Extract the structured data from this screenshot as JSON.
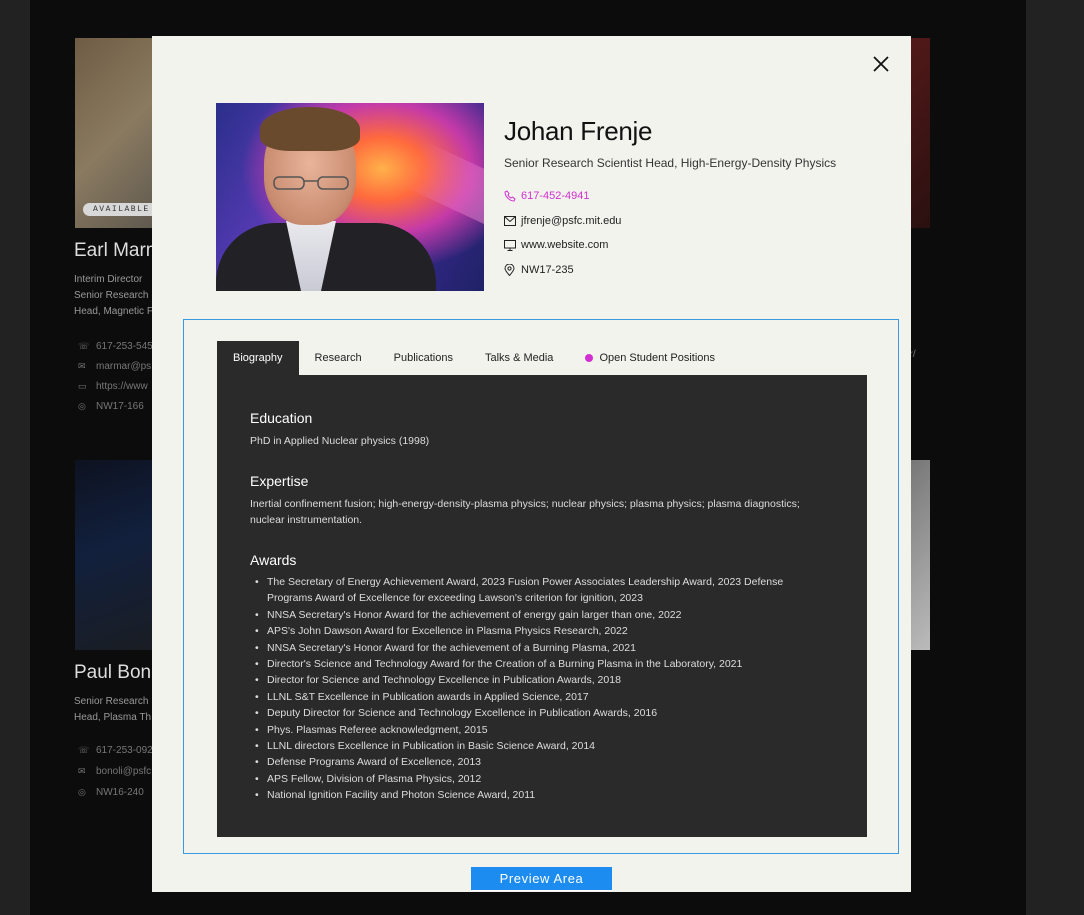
{
  "background": {
    "card1": {
      "badge": "AVAILABLE S",
      "name": "Earl Marm",
      "lines": [
        "Interim Director",
        "Senior Research",
        "Head, Magnetic F"
      ],
      "contacts": [
        "617-253-545",
        "marmar@ps",
        "https://www",
        "NW17-166"
      ]
    },
    "card2": {
      "name": "Paul Bonol",
      "lines": [
        "Senior Research",
        "Head, Plasma Th"
      ],
      "contacts": [
        "617-253-092",
        "bonoli@psfc",
        "NW16-240"
      ]
    },
    "side_text": "or/"
  },
  "modal": {
    "close_label": "",
    "name": "Johan Frenje",
    "title": "Senior Research Scientist Head, High-Energy-Density Physics",
    "phone": "617-452-4941",
    "email": "jfrenje@psfc.mit.edu",
    "website": "www.website.com",
    "location": "NW17-235",
    "tabs": [
      {
        "label": "Biography",
        "active": true
      },
      {
        "label": "Research"
      },
      {
        "label": "Publications"
      },
      {
        "label": "Talks & Media"
      },
      {
        "label": "Open Student Positions"
      }
    ],
    "biography": {
      "education_heading": "Education",
      "education_text": "PhD in Applied Nuclear physics (1998)",
      "expertise_heading": "Expertise",
      "expertise_text": "Inertial confinement fusion; high-energy-density-plasma physics; nuclear physics; plasma physics; plasma diagnostics; nuclear instrumentation.",
      "awards_heading": "Awards",
      "awards": [
        "The Secretary of Energy Achievement Award, 2023 Fusion Power Associates Leadership Award, 2023 Defense Programs Award of Excellence for exceeding Lawson's criterion for ignition, 2023",
        "NNSA Secretary's Honor Award for the achievement of energy gain larger than one, 2022",
        "APS's John Dawson Award for Excellence in Plasma Physics Research, 2022",
        "NNSA Secretary's Honor Award for the achievement of a Burning Plasma, 2021",
        "Director's Science and Technology Award for the Creation of a Burning Plasma in the Laboratory, 2021",
        "Director for Science and Technology Excellence in Publication Awards, 2018",
        "LLNL S&T Excellence in Publication awards in Applied Science, 2017",
        "Deputy Director for Science and Technology Excellence in Publication Awards, 2016",
        "Phys. Plasmas Referee acknowledgment, 2015",
        "LLNL directors Excellence in Publication in Basic Science Award, 2014",
        "Defense Programs Award of Excellence, 2013",
        "APS Fellow, Division of Plasma Physics, 2012",
        "National Ignition Facility and Photon Science Award, 2011"
      ]
    },
    "preview_label": "Preview Area"
  },
  "colors": {
    "accent_magenta": "#d22fd0",
    "preview_blue": "#1d8cf0",
    "panel_dark": "#2a2a2a",
    "modal_bg": "#f3f3ee"
  }
}
